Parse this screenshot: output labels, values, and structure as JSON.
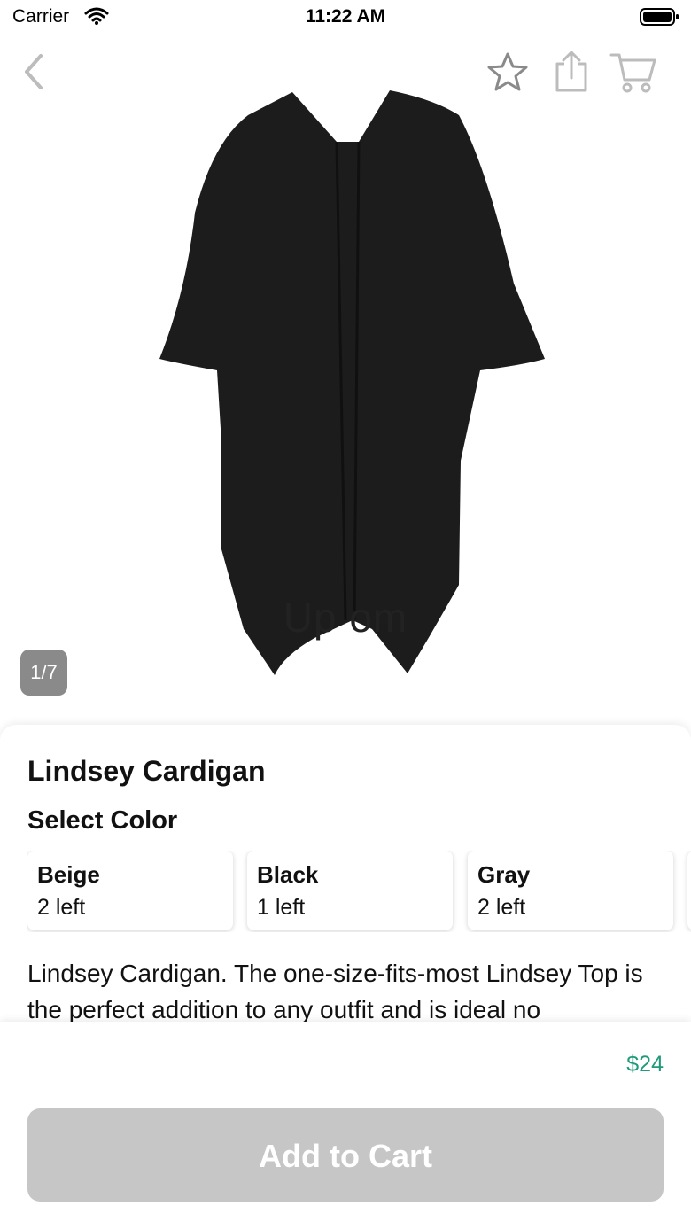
{
  "status": {
    "carrier": "Carrier",
    "time": "11:22 AM"
  },
  "hero": {
    "watermark": "Up        om",
    "page_indicator": "1/7"
  },
  "nav": {
    "back_icon": "chevron-left-icon",
    "favorite_icon": "star-icon",
    "share_icon": "share-icon",
    "cart_icon": "cart-icon"
  },
  "product": {
    "title": "Lindsey Cardigan",
    "select_color_label": "Select Color",
    "colors": [
      {
        "name": "Beige",
        "stock": "2 left"
      },
      {
        "name": "Black",
        "stock": "1 left"
      },
      {
        "name": "Gray",
        "stock": "2 left"
      }
    ],
    "description": "Lindsey Cardigan. The one-size-fits-most Lindsey Top is the perfect addition to any outfit and is ideal no"
  },
  "purchase": {
    "price": "$24",
    "add_to_cart_label": "Add to Cart"
  },
  "colors": {
    "price": "#1f9a7a",
    "button_disabled": "#c6c6c6",
    "indicator": "#8a8a8a"
  }
}
